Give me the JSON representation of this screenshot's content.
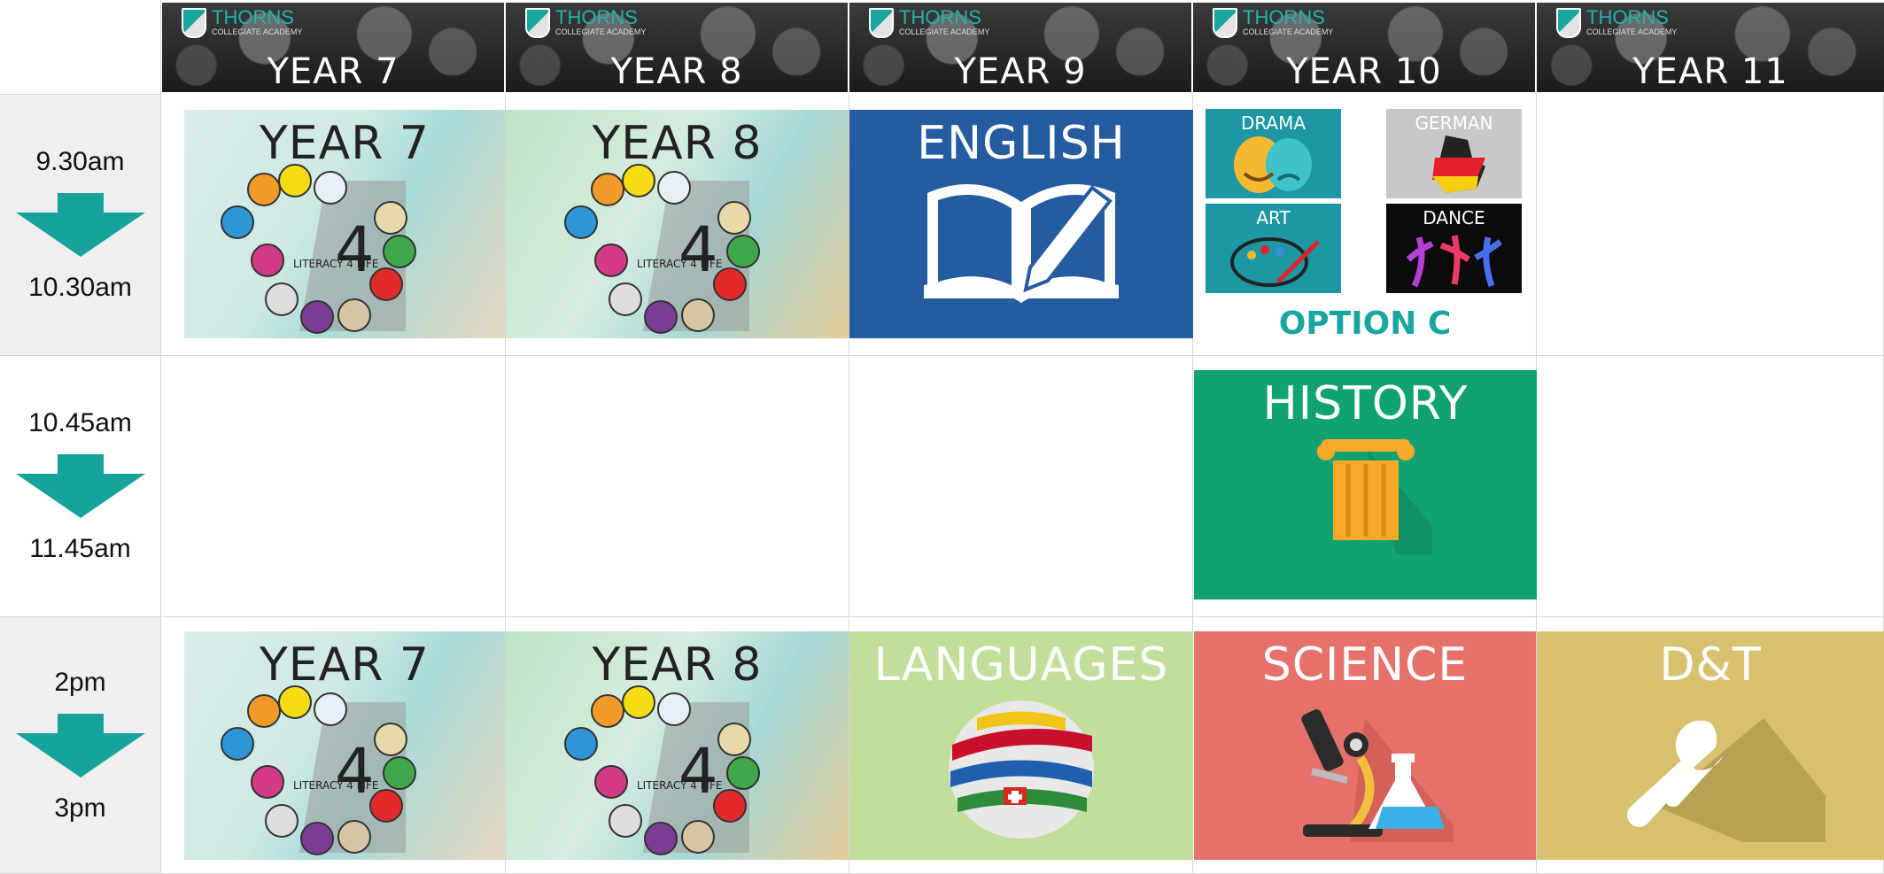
{
  "header": {
    "brand": "THORNS",
    "brand_sub": "COLLEGIATE ACADEMY",
    "years": [
      "YEAR 7",
      "YEAR 8",
      "YEAR 9",
      "YEAR 10",
      "YEAR 11"
    ]
  },
  "times": [
    {
      "start": "9.30am",
      "end": "10.30am"
    },
    {
      "start": "10.45am",
      "end": "11.45am"
    },
    {
      "start": "2pm",
      "end": "3pm"
    }
  ],
  "slots": {
    "s1": {
      "y7": "YEAR 7",
      "y8": "YEAR 8",
      "y9": "ENGLISH",
      "y10_options": [
        "DRAMA",
        "GERMAN",
        "ART",
        "DANCE"
      ],
      "y10_caption": "OPTION C"
    },
    "s2": {
      "y10": "HISTORY"
    },
    "s3": {
      "y7": "YEAR 7",
      "y8": "YEAR 8",
      "y9": "LANGUAGES",
      "y10": "SCIENCE",
      "y11": "D&T"
    }
  },
  "literacy_label": "LITERACY 4 LIFE",
  "literacy_number": "4",
  "colors": {
    "arrow": "#16a39b",
    "english": "#255b9f",
    "history": "#11a271",
    "languages": "#c1df9a",
    "science": "#e5716a",
    "dt": "#d8c16e",
    "option_c": "#1aa6a0"
  }
}
